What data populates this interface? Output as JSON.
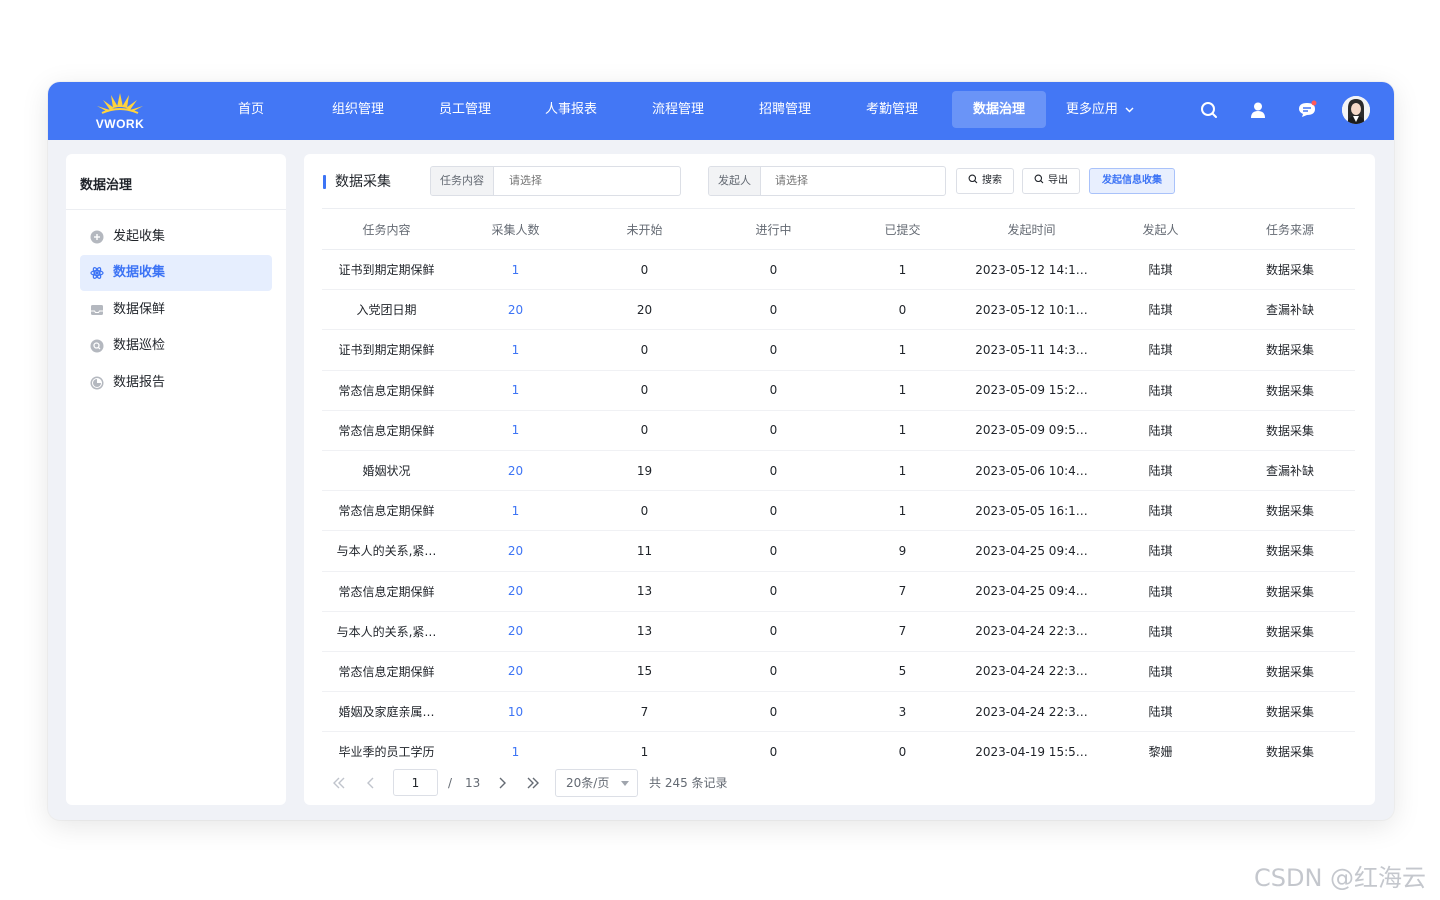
{
  "brand": {
    "logo_text": "VWORK"
  },
  "nav": {
    "items": [
      {
        "label": "首页"
      },
      {
        "label": "组织管理"
      },
      {
        "label": "员工管理"
      },
      {
        "label": "人事报表"
      },
      {
        "label": "流程管理"
      },
      {
        "label": "招聘管理"
      },
      {
        "label": "考勤管理"
      },
      {
        "label": "数据治理",
        "active": true
      },
      {
        "label": "更多应用"
      }
    ],
    "icons": [
      "search-icon",
      "user-icon",
      "message-icon",
      "avatar"
    ]
  },
  "sidebar": {
    "title": "数据治理",
    "items": [
      {
        "label": "发起收集",
        "icon": "plus-circle-icon"
      },
      {
        "label": "数据收集",
        "icon": "atom-icon",
        "active": true
      },
      {
        "label": "数据保鲜",
        "icon": "inbox-icon"
      },
      {
        "label": "数据巡检",
        "icon": "inspect-icon"
      },
      {
        "label": "数据报告",
        "icon": "report-icon"
      }
    ]
  },
  "main": {
    "title": "数据采集",
    "filters": {
      "task": {
        "label": "任务内容",
        "placeholder": "请选择"
      },
      "initiator": {
        "label": "发起人",
        "placeholder": "请选择"
      }
    },
    "buttons": {
      "search": "搜索",
      "export": "导出",
      "collect": "发起信息收集"
    },
    "table": {
      "columns": [
        "任务内容",
        "采集人数",
        "未开始",
        "进行中",
        "已提交",
        "发起时间",
        "发起人",
        "任务来源"
      ],
      "rows": [
        [
          "证书到期定期保鲜",
          "1",
          "0",
          "0",
          "1",
          "2023-05-12 14:1…",
          "陆琪",
          "数据采集"
        ],
        [
          "入党团日期",
          "20",
          "20",
          "0",
          "0",
          "2023-05-12 10:1…",
          "陆琪",
          "查漏补缺"
        ],
        [
          "证书到期定期保鲜",
          "1",
          "0",
          "0",
          "1",
          "2023-05-11 14:3…",
          "陆琪",
          "数据采集"
        ],
        [
          "常态信息定期保鲜",
          "1",
          "0",
          "0",
          "1",
          "2023-05-09 15:2…",
          "陆琪",
          "数据采集"
        ],
        [
          "常态信息定期保鲜",
          "1",
          "0",
          "0",
          "1",
          "2023-05-09 09:5…",
          "陆琪",
          "数据采集"
        ],
        [
          "婚姻状况",
          "20",
          "19",
          "0",
          "1",
          "2023-05-06 10:4…",
          "陆琪",
          "查漏补缺"
        ],
        [
          "常态信息定期保鲜",
          "1",
          "0",
          "0",
          "1",
          "2023-05-05 16:1…",
          "陆琪",
          "数据采集"
        ],
        [
          "与本人的关系,紧…",
          "20",
          "11",
          "0",
          "9",
          "2023-04-25 09:4…",
          "陆琪",
          "数据采集"
        ],
        [
          "常态信息定期保鲜",
          "20",
          "13",
          "0",
          "7",
          "2023-04-25 09:4…",
          "陆琪",
          "数据采集"
        ],
        [
          "与本人的关系,紧…",
          "20",
          "13",
          "0",
          "7",
          "2023-04-24 22:3…",
          "陆琪",
          "数据采集"
        ],
        [
          "常态信息定期保鲜",
          "20",
          "15",
          "0",
          "5",
          "2023-04-24 22:3…",
          "陆琪",
          "数据采集"
        ],
        [
          "婚姻及家庭亲属…",
          "10",
          "7",
          "0",
          "3",
          "2023-04-24 22:3…",
          "陆琪",
          "数据采集"
        ],
        [
          "毕业季的员工学历",
          "1",
          "1",
          "0",
          "0",
          "2023-04-19 15:5…",
          "黎姗",
          "数据采集"
        ]
      ]
    },
    "pagination": {
      "current_page": "1",
      "separator": "/",
      "total_pages": "13",
      "page_size": "20条/页",
      "total_text": "共 245 条记录"
    }
  },
  "watermark": "CSDN @红海云",
  "colors": {
    "primary": "#4377f5",
    "accent": "#3d74f5",
    "background": "#f0f2f7"
  }
}
